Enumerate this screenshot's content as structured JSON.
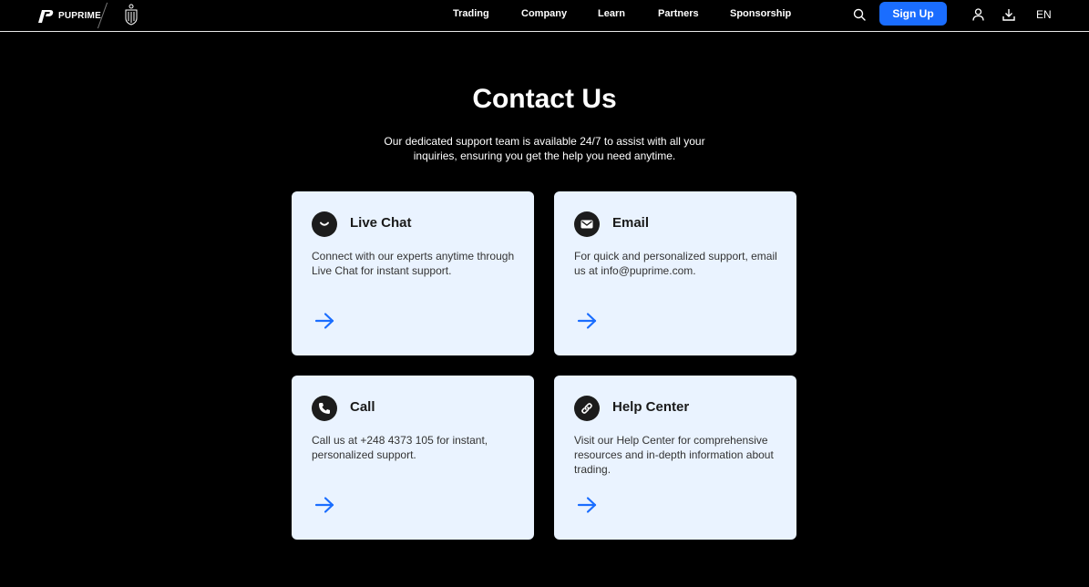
{
  "header": {
    "brand_name": "PUPRIME",
    "nav": [
      "Trading",
      "Company",
      "Learn",
      "Partners",
      "Sponsorship"
    ],
    "signup_label": "Sign Up",
    "language": "EN"
  },
  "page": {
    "title": "Contact Us",
    "subtitle": "Our dedicated support team is available 24/7 to assist with all your inquiries, ensuring you get the help you need anytime."
  },
  "cards": [
    {
      "icon": "chat-icon",
      "title": "Live Chat",
      "desc": "Connect with our experts anytime through Live Chat for instant support."
    },
    {
      "icon": "email-icon",
      "title": "Email",
      "desc": "For quick and personalized support, email us at info@puprime.com."
    },
    {
      "icon": "phone-icon",
      "title": "Call",
      "desc": "Call us at +248 4373 105 for instant, personalized support."
    },
    {
      "icon": "link-icon",
      "title": "Help Center",
      "desc": "Visit our Help Center for comprehensive resources and in-depth information about trading."
    }
  ],
  "colors": {
    "accent": "#1a6dff",
    "card_bg": "#eaf3ff",
    "arrow": "#1a6dff"
  }
}
